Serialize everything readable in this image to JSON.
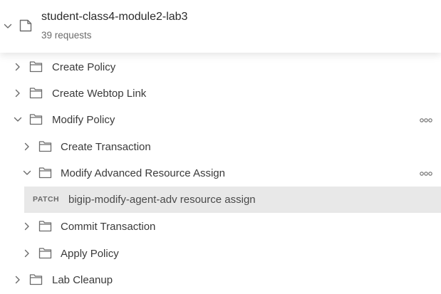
{
  "collection": {
    "name": "student-class4-module2-lab3",
    "subtitle": "39 requests"
  },
  "tree": {
    "create_policy": "Create Policy",
    "create_webtop_link": "Create Webtop Link",
    "modify_policy": "Modify Policy",
    "create_transaction": "Create Transaction",
    "modify_advanced_resource_assign": "Modify Advanced Resource Assign",
    "request": {
      "method": "PATCH",
      "name": "bigip-modify-agent-adv resource assign"
    },
    "commit_transaction": "Commit Transaction",
    "apply_policy": "Apply Policy",
    "lab_cleanup": "Lab Cleanup"
  },
  "colors": {
    "selected_row": "#e8e8e8",
    "icon_stroke": "#6b6b6b",
    "text": "#3a3a3a"
  },
  "icons": {
    "collapsed": "chevron-right-icon",
    "expanded": "chevron-down-icon",
    "folder": "folder-icon",
    "collection": "collection-icon",
    "more": "more-horizontal-icon"
  }
}
